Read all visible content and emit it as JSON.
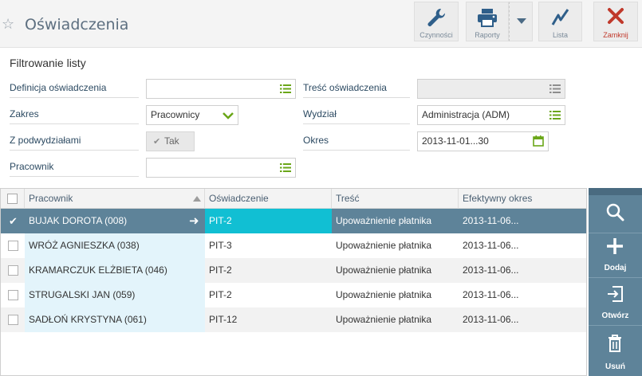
{
  "header": {
    "title": "Oświadczenia",
    "buttons": {
      "czynnosci": "Czynności",
      "raporty": "Raporty",
      "lista": "Lista",
      "zamknij": "Zamknij"
    }
  },
  "filter": {
    "title": "Filtrowanie listy",
    "definicja_label": "Definicja oświadczenia",
    "definicja_value": "",
    "tresc_label": "Treść oświadczenia",
    "tresc_value": "",
    "zakres_label": "Zakres",
    "zakres_value": "Pracownicy",
    "wydzial_label": "Wydział",
    "wydzial_value": "Administracja (ADM)",
    "podwydzialy_label": "Z podwydziałami",
    "podwydzialy_value": "Tak",
    "okres_label": "Okres",
    "okres_value": "2013-11-01...30",
    "pracownik_label": "Pracownik",
    "pracownik_value": ""
  },
  "grid": {
    "columns": [
      "Pracownik",
      "Oświadczenie",
      "Treść",
      "Efektywny okres"
    ],
    "rows": [
      {
        "pracownik": "BUJAK DOROTA (008)",
        "osw": "PIT-2",
        "tresc": "Upoważnienie płatnika",
        "okres": "2013-11-06..."
      },
      {
        "pracownik": "WRÓŻ AGNIESZKA (038)",
        "osw": "PIT-3",
        "tresc": "Upoważnienie płatnika",
        "okres": "2013-11-06..."
      },
      {
        "pracownik": "KRAMARCZUK ELŻBIETA (046)",
        "osw": "PIT-2",
        "tresc": "Upoważnienie płatnika",
        "okres": "2013-11-06..."
      },
      {
        "pracownik": "STRUGALSKI JAN (059)",
        "osw": "PIT-2",
        "tresc": "Upoważnienie płatnika",
        "okres": "2013-11-06..."
      },
      {
        "pracownik": "SADŁOŃ KRYSTYNA (061)",
        "osw": "PIT-12",
        "tresc": "Upoważnienie płatnika",
        "okres": "2013-11-06..."
      }
    ]
  },
  "side": {
    "dodaj": "Dodaj",
    "otworz": "Otwórz",
    "usun": "Usuń"
  },
  "colors": {
    "accent_green": "#6aa618",
    "selected_row": "#5e8399",
    "selected_cell": "#11bfd3",
    "close_red": "#c0392b"
  }
}
